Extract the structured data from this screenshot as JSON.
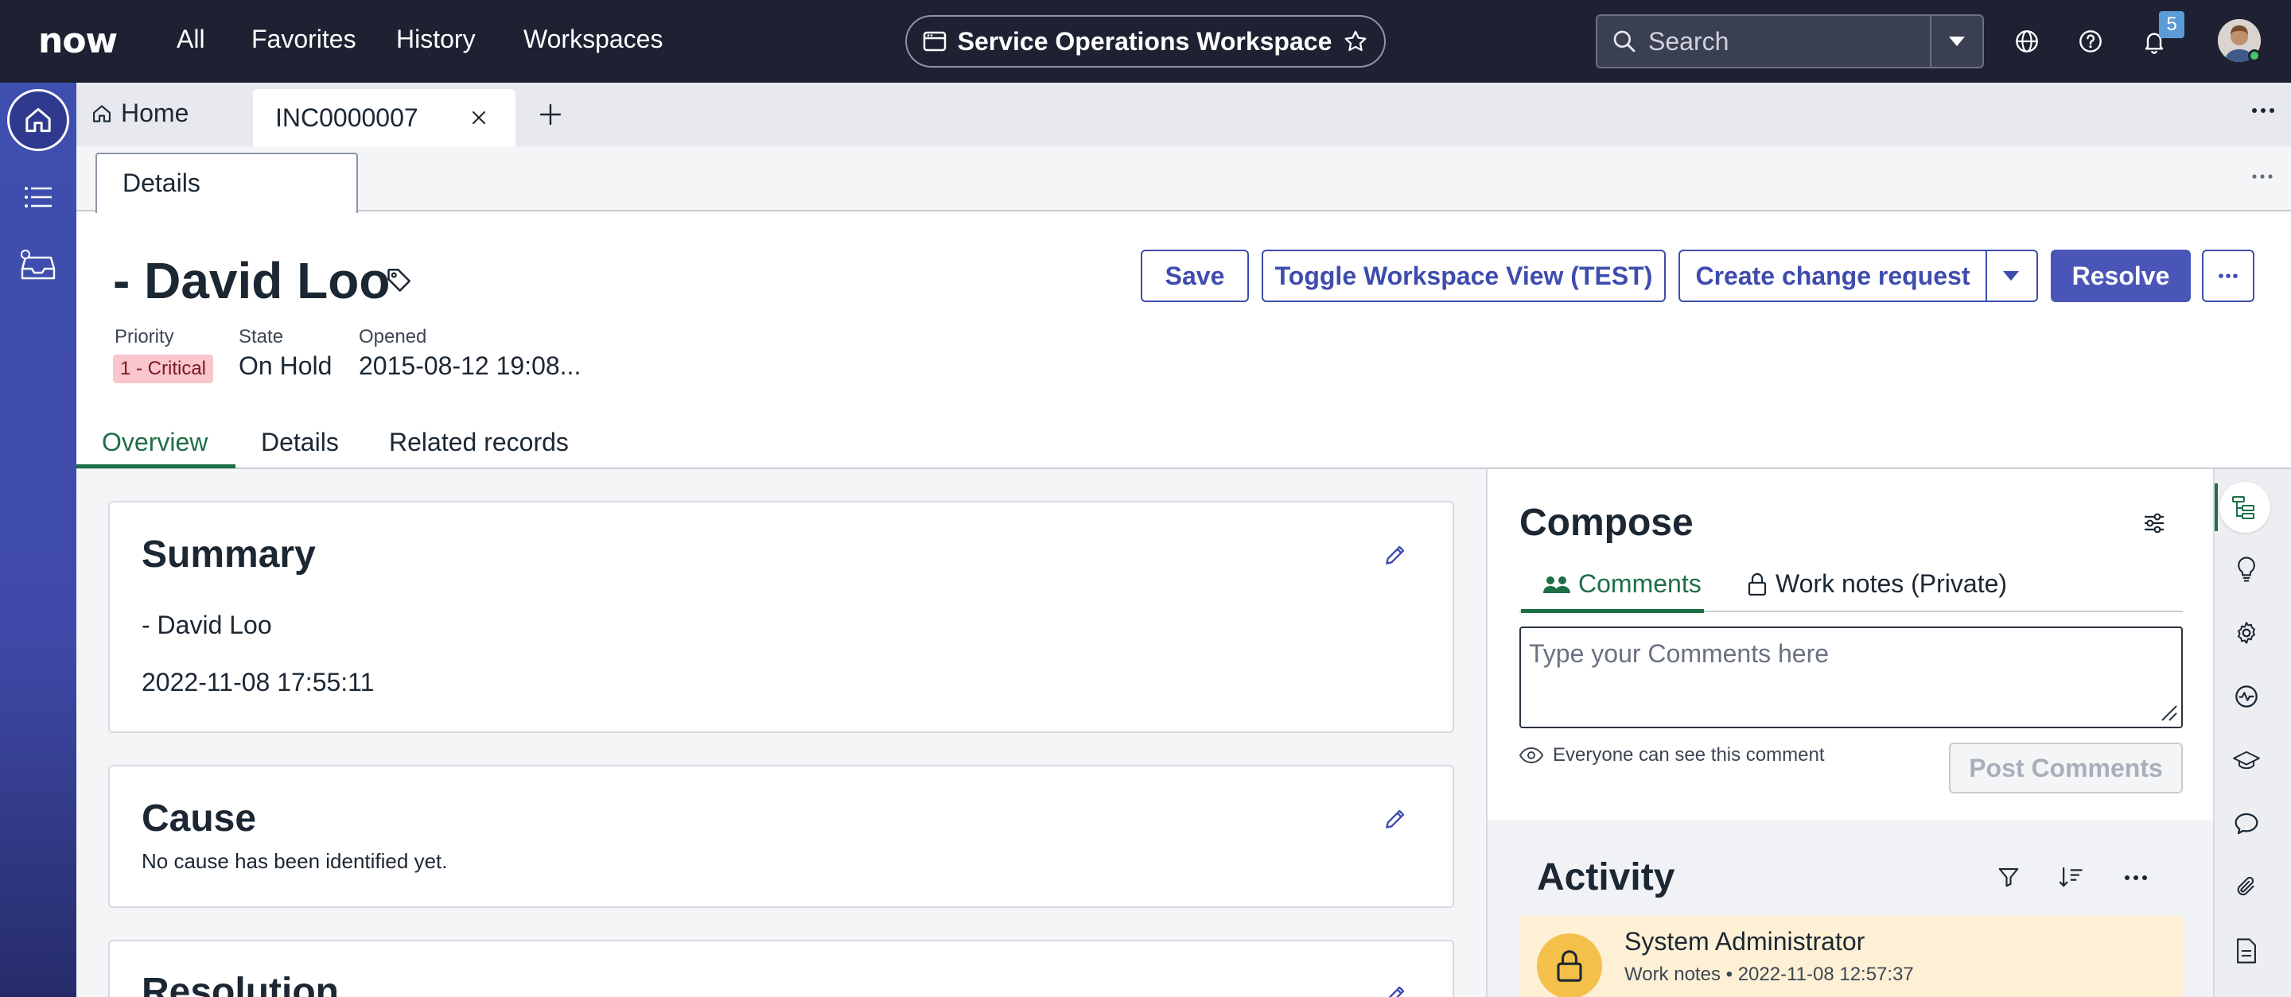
{
  "topnav": {
    "logo": "now",
    "items": [
      "All",
      "Favorites",
      "History",
      "Workspaces"
    ],
    "workspace": "Service Operations Workspace",
    "search_placeholder": "Search",
    "notification_count": "5"
  },
  "tabs": {
    "home": "Home",
    "active": "INC0000007"
  },
  "subtab": "Details",
  "record": {
    "title": "- David Loo",
    "actions": {
      "save": "Save",
      "toggle": "Toggle Workspace View (TEST)",
      "create_change": "Create change request",
      "resolve": "Resolve"
    },
    "meta": {
      "priority_label": "Priority",
      "priority_value": "1 - Critical",
      "state_label": "State",
      "state_value": "On Hold",
      "opened_label": "Opened",
      "opened_value": "2015-08-12 19:08..."
    },
    "tabs": [
      "Overview",
      "Details",
      "Related records"
    ]
  },
  "summary": {
    "title": "Summary",
    "line1": "- David Loo",
    "line2": "2022-11-08 17:55:11"
  },
  "cause": {
    "title": "Cause",
    "text": "No cause has been identified yet."
  },
  "resolution": {
    "title": "Resolution"
  },
  "compose": {
    "title": "Compose",
    "tab_comments": "Comments",
    "tab_worknotes": "Work notes (Private)",
    "placeholder": "Type your Comments here",
    "visibility": "Everyone can see this comment",
    "post": "Post Comments"
  },
  "activity": {
    "title": "Activity",
    "entry_name": "System Administrator",
    "entry_type": "Work notes",
    "entry_time": "2022-11-08 12:57:37"
  },
  "colors": {
    "topbar": "#1e2132",
    "sidebar": "#3f4fb0",
    "accent": "#4a55b8",
    "active_tab": "#1e6e46",
    "critical_bg": "#f8c6cc",
    "worknote_bg": "#fdf0d5"
  }
}
